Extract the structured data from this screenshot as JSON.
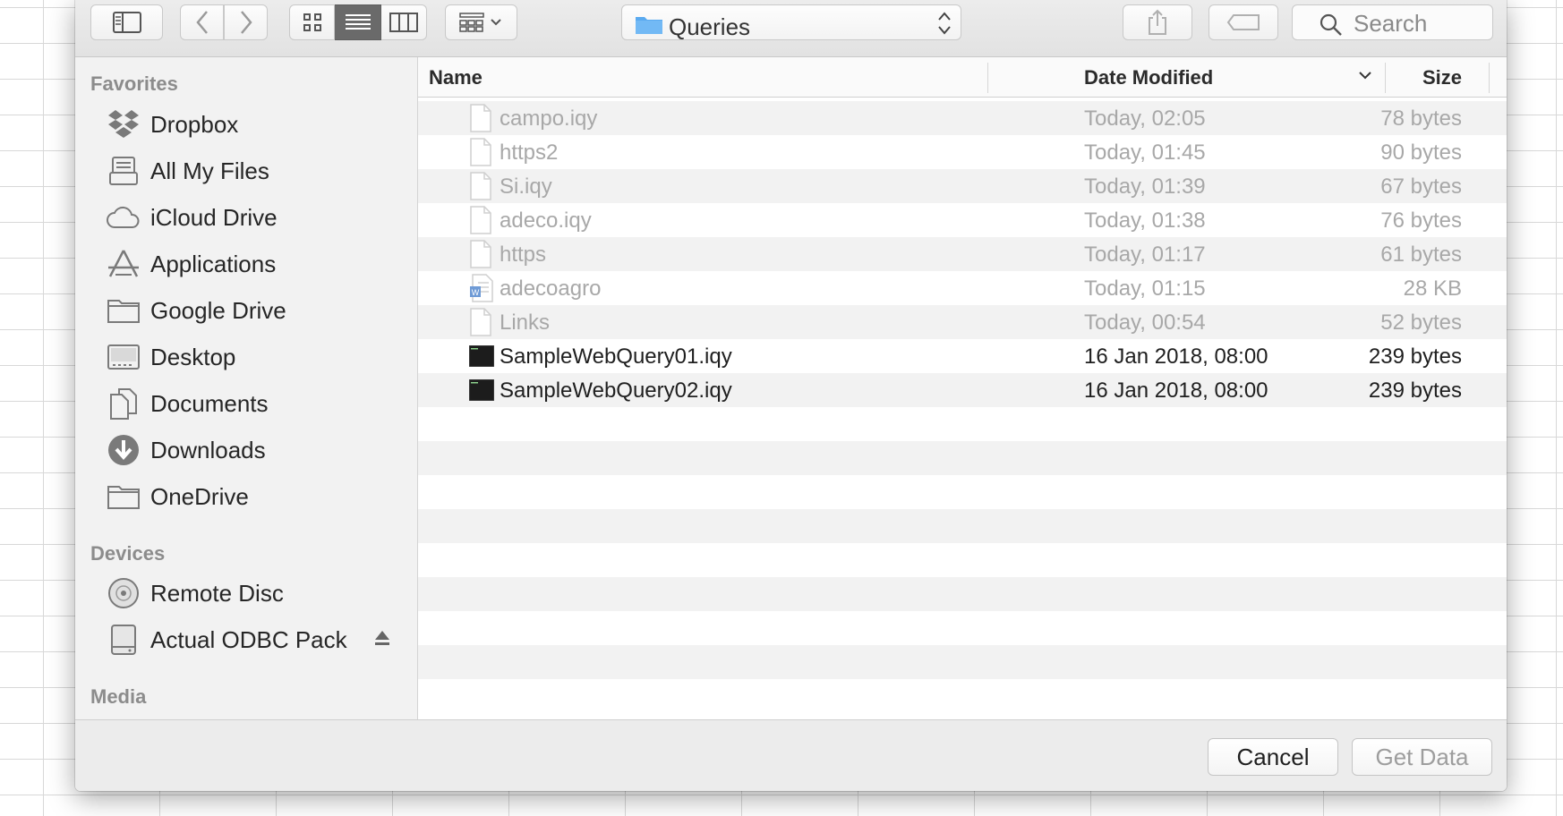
{
  "path_popup": {
    "label": "Queries"
  },
  "search": {
    "placeholder": "Search"
  },
  "sidebar": {
    "favorites_heading": "Favorites",
    "favorites": [
      {
        "label": "Dropbox",
        "icon": "dropbox-icon"
      },
      {
        "label": "All My Files",
        "icon": "all-my-files-icon"
      },
      {
        "label": "iCloud Drive",
        "icon": "cloud-icon"
      },
      {
        "label": "Applications",
        "icon": "applications-icon"
      },
      {
        "label": "Google Drive",
        "icon": "folder-icon"
      },
      {
        "label": "Desktop",
        "icon": "desktop-icon"
      },
      {
        "label": "Documents",
        "icon": "documents-icon"
      },
      {
        "label": "Downloads",
        "icon": "downloads-icon"
      },
      {
        "label": "OneDrive",
        "icon": "folder-icon"
      }
    ],
    "devices_heading": "Devices",
    "devices": [
      {
        "label": "Remote Disc",
        "icon": "disc-icon"
      },
      {
        "label": "Actual ODBC Pack",
        "icon": "drive-icon"
      }
    ],
    "media_heading": "Media"
  },
  "columns": {
    "name": "Name",
    "date": "Date Modified",
    "size": "Size"
  },
  "files": [
    {
      "name": "campo.iqy",
      "date": "Today, 02:05",
      "size": "78 bytes",
      "icon": "document-icon",
      "enabled": false
    },
    {
      "name": "https2",
      "date": "Today, 01:45",
      "size": "90 bytes",
      "icon": "document-icon",
      "enabled": false
    },
    {
      "name": "Si.iqy",
      "date": "Today, 01:39",
      "size": "67 bytes",
      "icon": "document-icon",
      "enabled": false
    },
    {
      "name": "adeco.iqy",
      "date": "Today, 01:38",
      "size": "76 bytes",
      "icon": "document-icon",
      "enabled": false
    },
    {
      "name": "https",
      "date": "Today, 01:17",
      "size": "61 bytes",
      "icon": "document-icon",
      "enabled": false
    },
    {
      "name": "adecoagro",
      "date": "Today, 01:15",
      "size": "28 KB",
      "icon": "word-document-icon",
      "enabled": false
    },
    {
      "name": "Links",
      "date": "Today, 00:54",
      "size": "52 bytes",
      "icon": "document-icon",
      "enabled": false
    },
    {
      "name": "SampleWebQuery01.iqy",
      "date": "16 Jan 2018, 08:00",
      "size": "239 bytes",
      "icon": "terminal-file-icon",
      "enabled": true
    },
    {
      "name": "SampleWebQuery02.iqy",
      "date": "16 Jan 2018, 08:00",
      "size": "239 bytes",
      "icon": "terminal-file-icon",
      "enabled": true
    }
  ],
  "footer": {
    "cancel_label": "Cancel",
    "get_data_label": "Get Data"
  },
  "colors": {
    "folder_blue": "#5aaaf0",
    "disabled_text": "#a8a8a8",
    "active_segment": "#6a6a6a"
  }
}
